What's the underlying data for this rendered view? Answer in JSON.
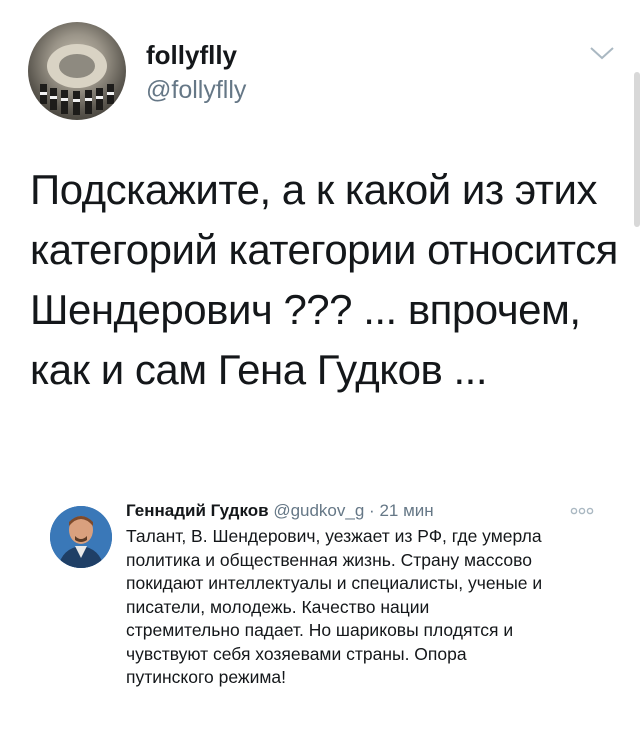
{
  "tweet": {
    "author": {
      "display_name": "follyflly",
      "handle": "@follyflly"
    },
    "text": "Подскажите, а к какой из этих категорий категории относится Шендерович ??? ... впрочем, как и сам Гена Гудков ...",
    "menu_icon": "chevron-down-icon"
  },
  "quoted_tweet": {
    "author_name": "Геннадий Гудков",
    "handle": "@gudkov_g",
    "separator": "·",
    "time": "21 мин",
    "more_icon": "more-icon",
    "text": "Талант, В. Шендерович, уезжает из РФ, где умерла\nполитика и общественная жизнь. Страну массово\nпокидают интеллектуалы и специалисты, ученые и\nписатели, молодежь. Качество нации\nстремительно падает. Но шариковы плодятся и\nчувствуют себя хозяевами  страны. Опора\nпутинского режима!"
  }
}
